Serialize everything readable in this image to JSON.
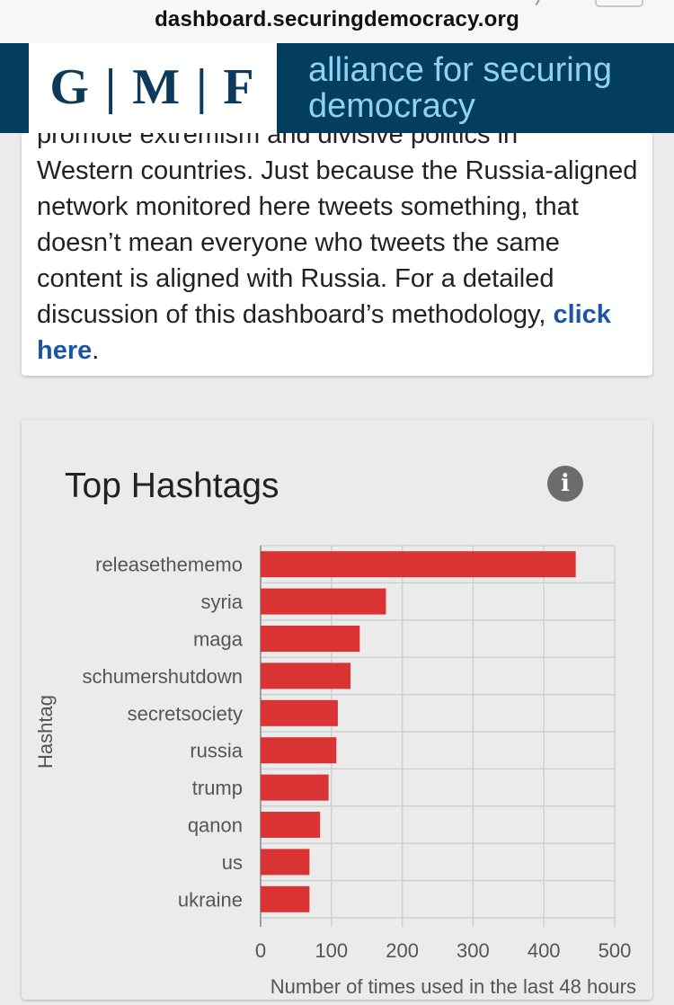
{
  "browser": {
    "url": "dashboard.securingdemocracy.org"
  },
  "header": {
    "logo_text": "G | M | F",
    "tagline": "alliance for securing democracy"
  },
  "intro": {
    "clipped_line": "promote extremism and divisive politics in",
    "text_before_link": "Western countries. Just because the Russia-aligned network monitored here tweets something, that doesn’t mean everyone who tweets the same content is aligned with Russia. For a detailed discussion of this dashboard’s methodology, ",
    "link_text": "click here",
    "text_after_link": "."
  },
  "chart_card": {
    "title": "Top Hashtags",
    "info_icon": "info-icon",
    "info_glyph": "i"
  },
  "chart_data": {
    "type": "bar",
    "orientation": "horizontal",
    "title": "Top Hashtags",
    "xlabel": "Number of times used in the last 48 hours",
    "ylabel": "Hashtag",
    "categories": [
      "releasethememo",
      "syria",
      "maga",
      "schumershutdown",
      "secretsociety",
      "russia",
      "trump",
      "qanon",
      "us",
      "ukraine"
    ],
    "values": [
      445,
      177,
      140,
      127,
      109,
      107,
      96,
      84,
      69,
      69
    ],
    "xlim": [
      0,
      500
    ],
    "xticks": [
      0,
      100,
      200,
      300,
      400,
      500
    ],
    "grid": true,
    "bar_color": "#d93333",
    "grid_color": "#cfcfcf"
  },
  "colors": {
    "header_bg": "#033e61",
    "tagline": "#8fd2f2",
    "link": "#1a56a6",
    "bar": "#d93333"
  }
}
